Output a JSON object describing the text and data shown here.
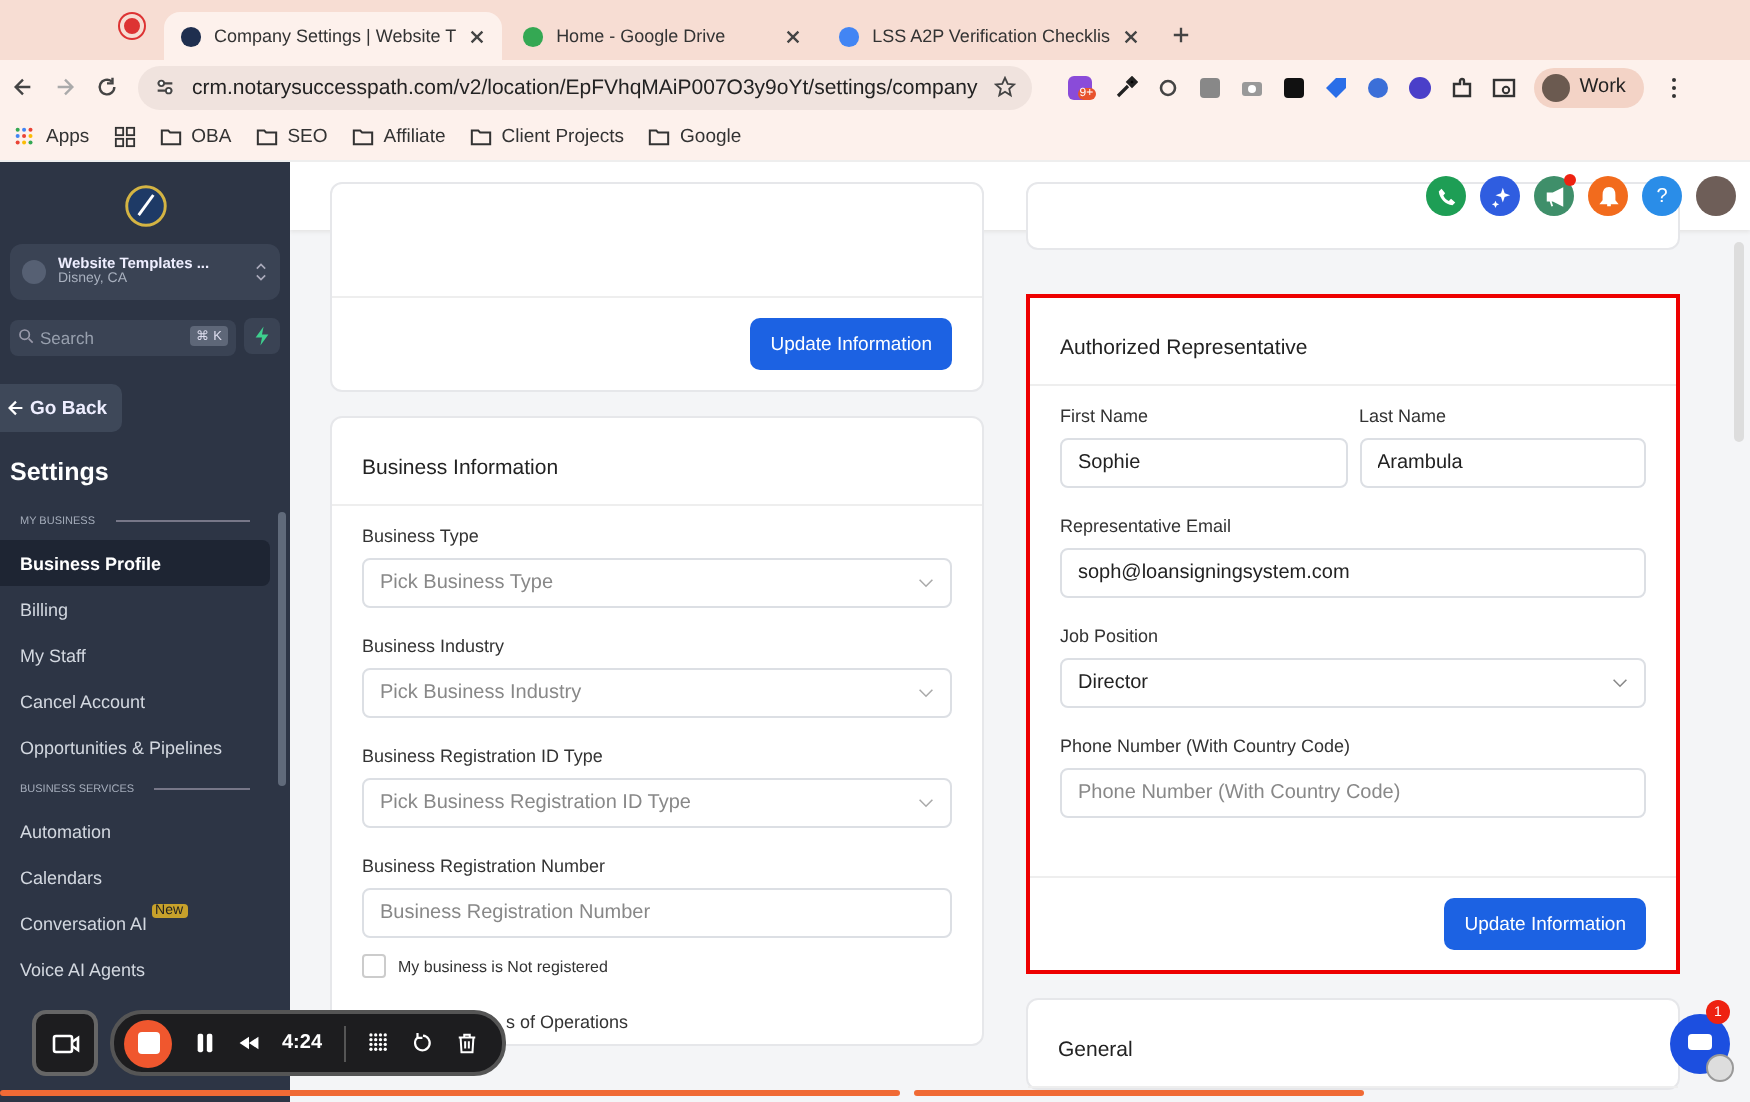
{
  "browser": {
    "tabs": [
      {
        "title": "Company Settings | Website T",
        "selected": true
      },
      {
        "title": "Home - Google Drive",
        "selected": false
      },
      {
        "title": "LSS A2P Verification Checklis",
        "selected": false
      }
    ],
    "url": "crm.notarysuccesspath.com/v2/location/EpFVhqMAiP007O3y9oYt/settings/company",
    "extension_badge": "9+",
    "profile": "Work",
    "bookmarks": [
      {
        "label": "Apps",
        "kind": "apps"
      },
      {
        "label": "OBA",
        "kind": "folder"
      },
      {
        "label": "SEO",
        "kind": "folder"
      },
      {
        "label": "Affiliate",
        "kind": "folder"
      },
      {
        "label": "Client Projects",
        "kind": "folder"
      },
      {
        "label": "Google",
        "kind": "folder"
      }
    ]
  },
  "sidebar": {
    "location": {
      "name": "Website Templates ...",
      "place": "Disney, CA"
    },
    "search": {
      "placeholder": "Search",
      "shortcut": "⌘ K"
    },
    "back": "Go Back",
    "title": "Settings",
    "sections": [
      {
        "heading": "MY BUSINESS",
        "items": [
          {
            "label": "Business Profile",
            "selected": true
          },
          {
            "label": "Billing",
            "selected": false
          },
          {
            "label": "My Staff",
            "selected": false
          },
          {
            "label": "Cancel Account",
            "selected": false
          },
          {
            "label": "Opportunities & Pipelines",
            "selected": false
          }
        ]
      },
      {
        "heading": "BUSINESS SERVICES",
        "items": [
          {
            "label": "Automation",
            "selected": false
          },
          {
            "label": "Calendars",
            "selected": false
          },
          {
            "label": "Conversation AI",
            "selected": false,
            "badge": "New"
          },
          {
            "label": "Voice AI Agents",
            "selected": false
          }
        ]
      }
    ]
  },
  "header": {
    "help": "?"
  },
  "left": {
    "top_button": "Update Information",
    "card": {
      "title": "Business Information",
      "fields": [
        {
          "label": "Business Type",
          "kind": "select",
          "placeholder": "Pick Business Type"
        },
        {
          "label": "Business Industry",
          "kind": "select",
          "placeholder": "Pick Business Industry"
        },
        {
          "label": "Business Registration ID Type",
          "kind": "select",
          "placeholder": "Pick Business Registration ID Type"
        },
        {
          "label": "Business Registration Number",
          "kind": "input",
          "placeholder": "Business Registration Number"
        }
      ],
      "checkbox": {
        "label": "My business is Not registered",
        "checked": false
      },
      "next_label": "s of Operations"
    }
  },
  "right": {
    "card": {
      "title": "Authorized Representative",
      "highlighted": true,
      "rows": [
        [
          {
            "label": "First Name",
            "kind": "input",
            "value": "Sophie"
          },
          {
            "label": "Last Name",
            "kind": "input",
            "value": "Arambula"
          }
        ],
        [
          {
            "label": "Representative Email",
            "kind": "input",
            "value": "soph@loansigningsystem.com"
          }
        ],
        [
          {
            "label": "Job Position",
            "kind": "select",
            "value": "Director"
          }
        ],
        [
          {
            "label": "Phone Number (With Country Code)",
            "kind": "input",
            "placeholder": "Phone Number (With Country Code)"
          }
        ]
      ],
      "button": "Update Information"
    },
    "next_card": "General"
  },
  "recorder": {
    "time": "4:24"
  },
  "chat": {
    "badge": "1"
  }
}
